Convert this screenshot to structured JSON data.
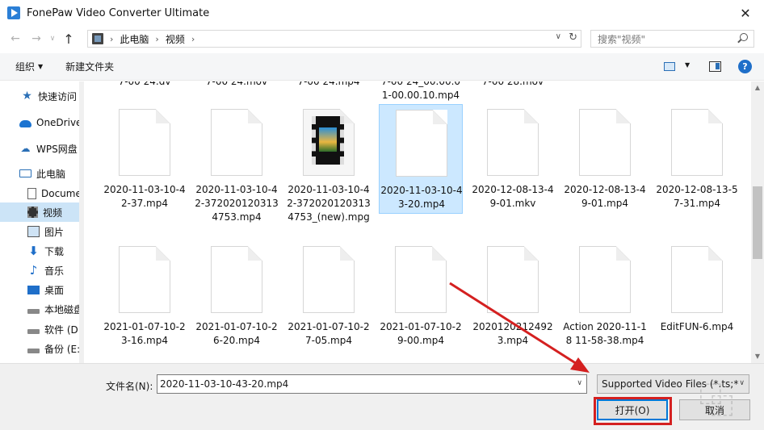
{
  "window": {
    "title": "FonePaw Video Converter Ultimate",
    "close_glyph": "✕"
  },
  "address": {
    "crumbs": [
      "此电脑",
      "视频"
    ],
    "search_placeholder": "搜索\"视频\""
  },
  "toolbar": {
    "organize": "组织",
    "new_folder": "新建文件夹"
  },
  "sidebar": {
    "items": [
      {
        "label": "快速访问",
        "icon": "star-icon"
      },
      {
        "label": "OneDrive",
        "icon": "cloud-icon"
      },
      {
        "label": "WPS网盘",
        "icon": "wps-cloud-icon"
      },
      {
        "label": "此电脑",
        "icon": "computer-icon"
      },
      {
        "label": "Documents",
        "icon": "document-icon"
      },
      {
        "label": "视频",
        "icon": "video-folder-icon",
        "selected": true
      },
      {
        "label": "图片",
        "icon": "picture-icon"
      },
      {
        "label": "下载",
        "icon": "download-icon"
      },
      {
        "label": "音乐",
        "icon": "music-icon"
      },
      {
        "label": "桌面",
        "icon": "desktop-icon"
      },
      {
        "label": "本地磁盘 (C:)",
        "icon": "disk-icon"
      },
      {
        "label": "软件 (D:)",
        "icon": "disk-icon"
      },
      {
        "label": "备份 (E:)",
        "icon": "disk-icon"
      }
    ]
  },
  "files": {
    "top_row": [
      "7-00 24.dv",
      "7-00 24.mov",
      "7-00 24.mp4",
      "7-00 24_00.00.01-00.00.10.mp4",
      "7-00 28.mov"
    ],
    "row1": [
      "2020-11-03-10-42-37.mp4",
      "2020-11-03-10-42-3720201203134753.mp4",
      "2020-11-03-10-42-3720201203134753_(new).mpg",
      "2020-11-03-10-43-20.mp4",
      "2020-12-08-13-49-01.mkv",
      "2020-12-08-13-49-01.mp4",
      "2020-12-08-13-57-31.mp4"
    ],
    "row2": [
      "2021-01-07-10-23-16.mp4",
      "2021-01-07-10-26-20.mp4",
      "2021-01-07-10-27-05.mp4",
      "2021-01-07-10-29-00.mp4",
      "20201202124923.mp4",
      "Action 2020-11-18 11-58-38.mp4",
      "EditFUN-6.mp4"
    ],
    "selected_index": 3
  },
  "bottom": {
    "filename_label": "文件名(N):",
    "filename_value": "2020-11-03-10-43-20.mp4",
    "filetype_value": "Supported Video Files (*.ts;*",
    "open_label": "打开(O)",
    "cancel_label": "取消"
  },
  "colors": {
    "accent": "#0078d7",
    "selection": "#cce8ff",
    "annotation_red": "#d42020"
  }
}
